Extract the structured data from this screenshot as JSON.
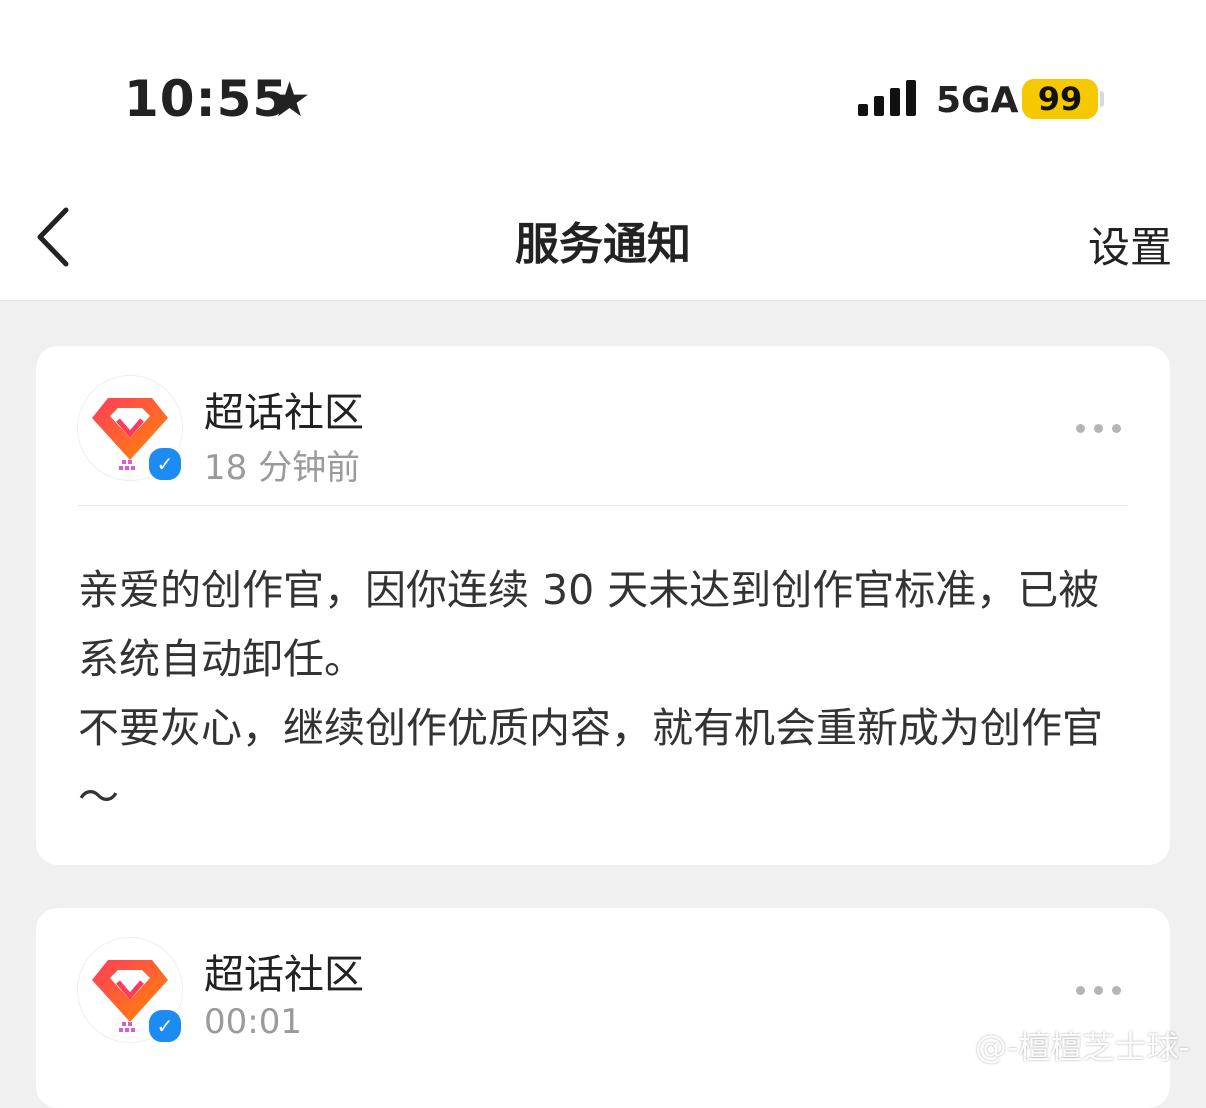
{
  "status_bar": {
    "time": "10:55",
    "network": "5GA",
    "battery": "99",
    "battery_color": "#f5c800"
  },
  "nav": {
    "title": "服务通知",
    "settings_label": "设置"
  },
  "messages": [
    {
      "sender": "超话社区",
      "time": "18 分钟前",
      "body": [
        "亲爱的创作官，因你连续 30 天未达到创作官标准，已被系统自动卸任。",
        "不要灰心，继续创作优质内容，就有机会重新成为创作官～"
      ]
    },
    {
      "sender": "超话社区",
      "time": "00:01"
    }
  ],
  "watermark": "@-檀檀芝士球-",
  "colors": {
    "verified_blue": "#1d8cf2",
    "background": "#f0f0f0"
  }
}
